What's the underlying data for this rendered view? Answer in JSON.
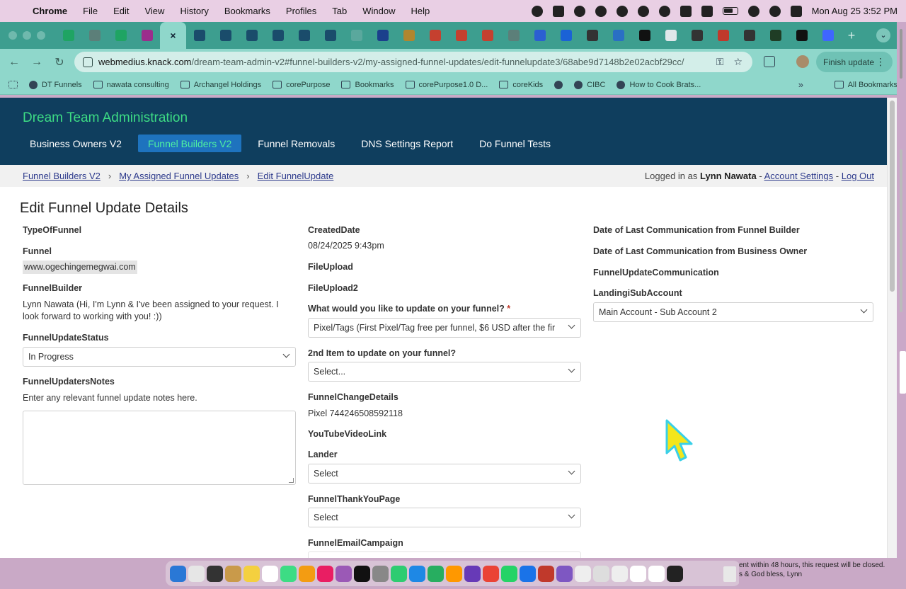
{
  "menubar": {
    "app_name": "Chrome",
    "items": [
      "File",
      "Edit",
      "View",
      "History",
      "Bookmarks",
      "Profiles",
      "Tab",
      "Window",
      "Help"
    ],
    "clock": "Mon Aug 25  3:52 PM"
  },
  "browser": {
    "active_tab_glyph": "×",
    "new_tab_glyph": "+",
    "tab_favicons": [
      {
        "name": "sheets-tab",
        "color": "#1fa463"
      },
      {
        "name": "globe-tab",
        "color": "#5c7f79"
      },
      {
        "name": "sheets-tab-2",
        "color": "#1fa463"
      },
      {
        "name": "asterisk-tab",
        "color": "#9b2d8c"
      },
      {
        "name": "active-tab",
        "color": "#1e3d59"
      },
      {
        "name": "vimeo-tab-1",
        "color": "#1a4c6b"
      },
      {
        "name": "vimeo-tab-2",
        "color": "#1a4c6b"
      },
      {
        "name": "vimeo-tab-3",
        "color": "#1a4c6b"
      },
      {
        "name": "vimeo-tab-4",
        "color": "#1a4c6b"
      },
      {
        "name": "vimeo-tab-5",
        "color": "#1a4c6b"
      },
      {
        "name": "vimeo-tab-6",
        "color": "#1a4c6b"
      },
      {
        "name": "lock-tab",
        "color": "#5aa89d"
      },
      {
        "name": "paypal-tab",
        "color": "#1b3f8c"
      },
      {
        "name": "tools-tab",
        "color": "#b0862e"
      },
      {
        "name": "gmail-tab-1",
        "color": "#c5402f"
      },
      {
        "name": "gmail-tab-2",
        "color": "#c5402f"
      },
      {
        "name": "gmail-tab-3",
        "color": "#c5402f"
      },
      {
        "name": "globe-tab-2",
        "color": "#5c7f79"
      },
      {
        "name": "dropbox-tab",
        "color": "#2b5fd1"
      },
      {
        "name": "facebook-tab",
        "color": "#1b62d6"
      },
      {
        "name": "zoho-tab",
        "color": "#333333"
      },
      {
        "name": "edge-tab",
        "color": "#2a6fc4"
      },
      {
        "name": "sk-tab",
        "color": "#111111"
      },
      {
        "name": "image-tab",
        "color": "#dfe7ea"
      },
      {
        "name": "openai-tab",
        "color": "#333333"
      },
      {
        "name": "red-cross-tab",
        "color": "#c0392b"
      },
      {
        "name": "spiral-tab",
        "color": "#333333"
      },
      {
        "name": "vertical-tab",
        "color": "#1f3d25"
      },
      {
        "name": "elementor-tab",
        "color": "#111111"
      },
      {
        "name": "star-tab",
        "color": "#3f66ff"
      }
    ],
    "url_host": "webmedius.knack.com",
    "url_path": "/dream-team-admin-v2#funnel-builders-v2/my-assigned-funnel-updates/edit-funnelupdate3/68abe9d7148b2e02acbf29cc/",
    "finish_update_label": "Finish update",
    "bookmarks": [
      {
        "label": "DT Funnels",
        "icon": "facebook-icon"
      },
      {
        "label": "nawata consulting",
        "icon": "folder-icon"
      },
      {
        "label": "Archangel Holdings",
        "icon": "folder-icon"
      },
      {
        "label": "corePurpose",
        "icon": "folder-icon"
      },
      {
        "label": "Bookmarks",
        "icon": "star-icon"
      },
      {
        "label": "corePurpose1.0 D...",
        "icon": "doc-icon"
      },
      {
        "label": "coreKids",
        "icon": "folder-icon"
      },
      {
        "label": "",
        "icon": "globe-icon"
      },
      {
        "label": "CIBC",
        "icon": "cibc-icon"
      },
      {
        "label": "How to Cook Brats...",
        "icon": "video-icon"
      }
    ],
    "all_bookmarks_label": "All Bookmarks"
  },
  "app": {
    "title": "Dream Team Administration",
    "nav": [
      {
        "label": "Business Owners V2",
        "active": false
      },
      {
        "label": "Funnel Builders V2",
        "active": true
      },
      {
        "label": "Funnel Removals",
        "active": false
      },
      {
        "label": "DNS Settings Report",
        "active": false
      },
      {
        "label": "Do Funnel Tests",
        "active": false
      }
    ],
    "breadcrumbs": [
      "Funnel Builders V2",
      "My Assigned Funnel Updates",
      "Edit FunnelUpdate"
    ],
    "breadcrumb_sep": "›",
    "login": {
      "prefix": "Logged in as",
      "user": "Lynn Nawata",
      "dash": "-",
      "account_settings": "Account Settings",
      "logout": "Log Out"
    }
  },
  "form": {
    "title": "Edit Funnel Update Details",
    "col1": {
      "type_label": "TypeOfFunnel",
      "funnel_label": "Funnel",
      "funnel_value": "www.ogechingemegwai.com",
      "builder_label": "FunnelBuilder",
      "builder_value": "Lynn Nawata (Hi, I'm Lynn & I've been assigned to your request. I look forward to working with you! :))",
      "status_label": "FunnelUpdateStatus",
      "status_value": "In Progress",
      "notes_label": "FunnelUpdatersNotes",
      "notes_help": "Enter any relevant funnel update notes here."
    },
    "col2": {
      "created_label": "CreatedDate",
      "created_value": "08/24/2025 9:43pm",
      "upload1_label": "FileUpload",
      "upload2_label": "FileUpload2",
      "update_label": "What would you like to update on your funnel?",
      "required_mark": "*",
      "update_value": "Pixel/Tags (First Pixel/Tag free per funnel, $6 USD after the fir",
      "second_label": "2nd Item to update on your funnel?",
      "second_value": "Select...",
      "details_label": "FunnelChangeDetails",
      "details_value": "Pixel 744246508592118",
      "youtube_label": "YouTubeVideoLink",
      "lander_label": "Lander",
      "lander_value": "Select",
      "thankyou_label": "FunnelThankYouPage",
      "thankyou_value": "Select",
      "email_label": "FunnelEmailCampaign"
    },
    "col3": {
      "last_builder_label": "Date of Last Communication from Funnel Builder",
      "last_owner_label": "Date of Last Communication from Business Owner",
      "communication_label": "FunnelUpdateCommunication",
      "subaccount_label": "LandingiSubAccount",
      "subaccount_value": "Main Account - Sub Account 2"
    }
  },
  "notification": {
    "line1": "ent within 48 hours, this request will be closed.",
    "line2": "s & God bless, Lynn"
  },
  "dock_colors": [
    "#2a78d6",
    "#e6e6e6",
    "#333333",
    "#c99a4a",
    "#f4d03f",
    "#ffffff",
    "#3ddc84",
    "#f39c12",
    "#e91e63",
    "#9b59b6",
    "#111111",
    "#888888",
    "#2ecc71",
    "#1e88e5",
    "#27ae60",
    "#ff9800",
    "#673ab7",
    "#ea4335",
    "#25d366",
    "#1a73e8",
    "#c0392b",
    "#7e57c2",
    "#eeeeee",
    "#dddddd",
    "#eeeeee",
    "#ffffff",
    "#ffffff",
    "#222222"
  ]
}
